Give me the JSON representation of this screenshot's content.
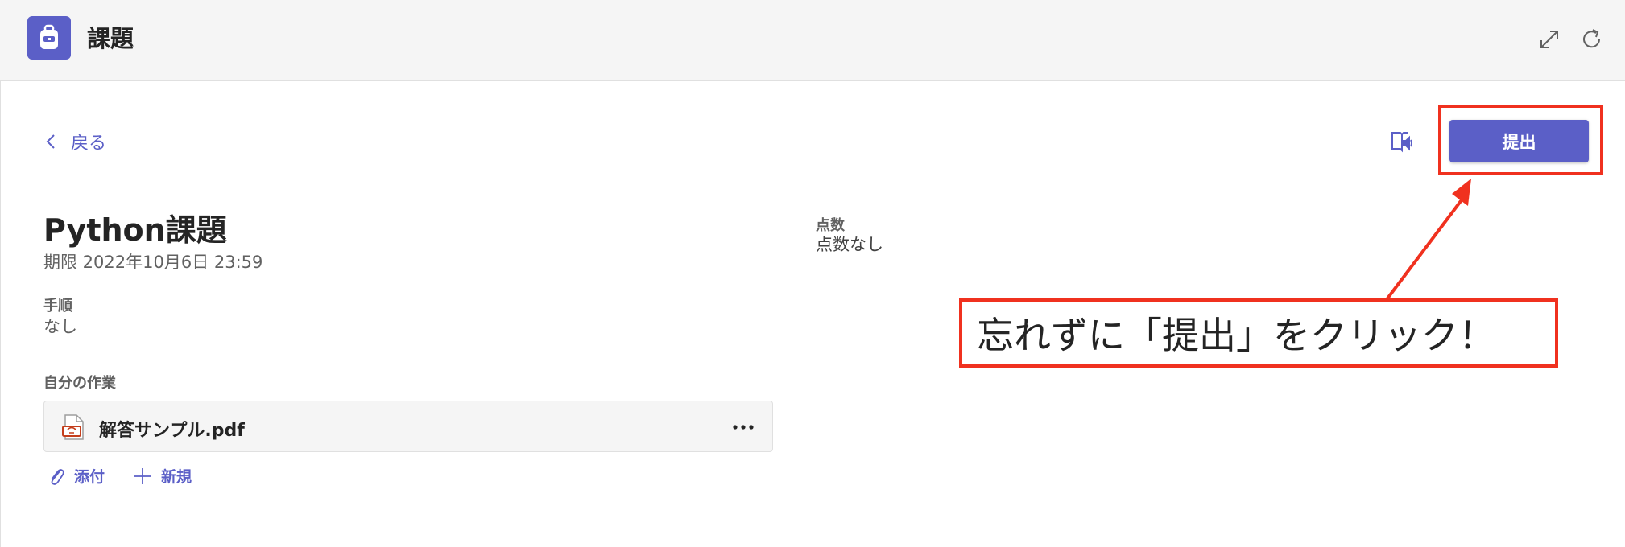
{
  "header": {
    "app_title": "課題",
    "app_icon": "backpack-icon",
    "expand_icon": "expand-icon",
    "refresh_icon": "refresh-icon"
  },
  "toolbar": {
    "back_label": "戻る",
    "reader_icon": "immersive-reader-icon",
    "submit_label": "提出"
  },
  "assignment": {
    "title": "Python課題",
    "due": "期限 2022年10月6日 23:59",
    "instructions_label": "手順",
    "instructions_value": "なし",
    "my_work_label": "自分の作業",
    "score_label": "点数",
    "score_value": "点数なし"
  },
  "file": {
    "name": "解答サンプル.pdf",
    "icon": "pdf-file-icon",
    "more_icon": "more-options-icon"
  },
  "actions": {
    "attach_label": "添付",
    "new_label": "新規"
  },
  "annotation": {
    "callout_text": "忘れずに「提出」をクリック！"
  },
  "colors": {
    "accent": "#5b5fc7",
    "annotation_red": "#f0311f",
    "header_bg": "#f5f5f5"
  }
}
